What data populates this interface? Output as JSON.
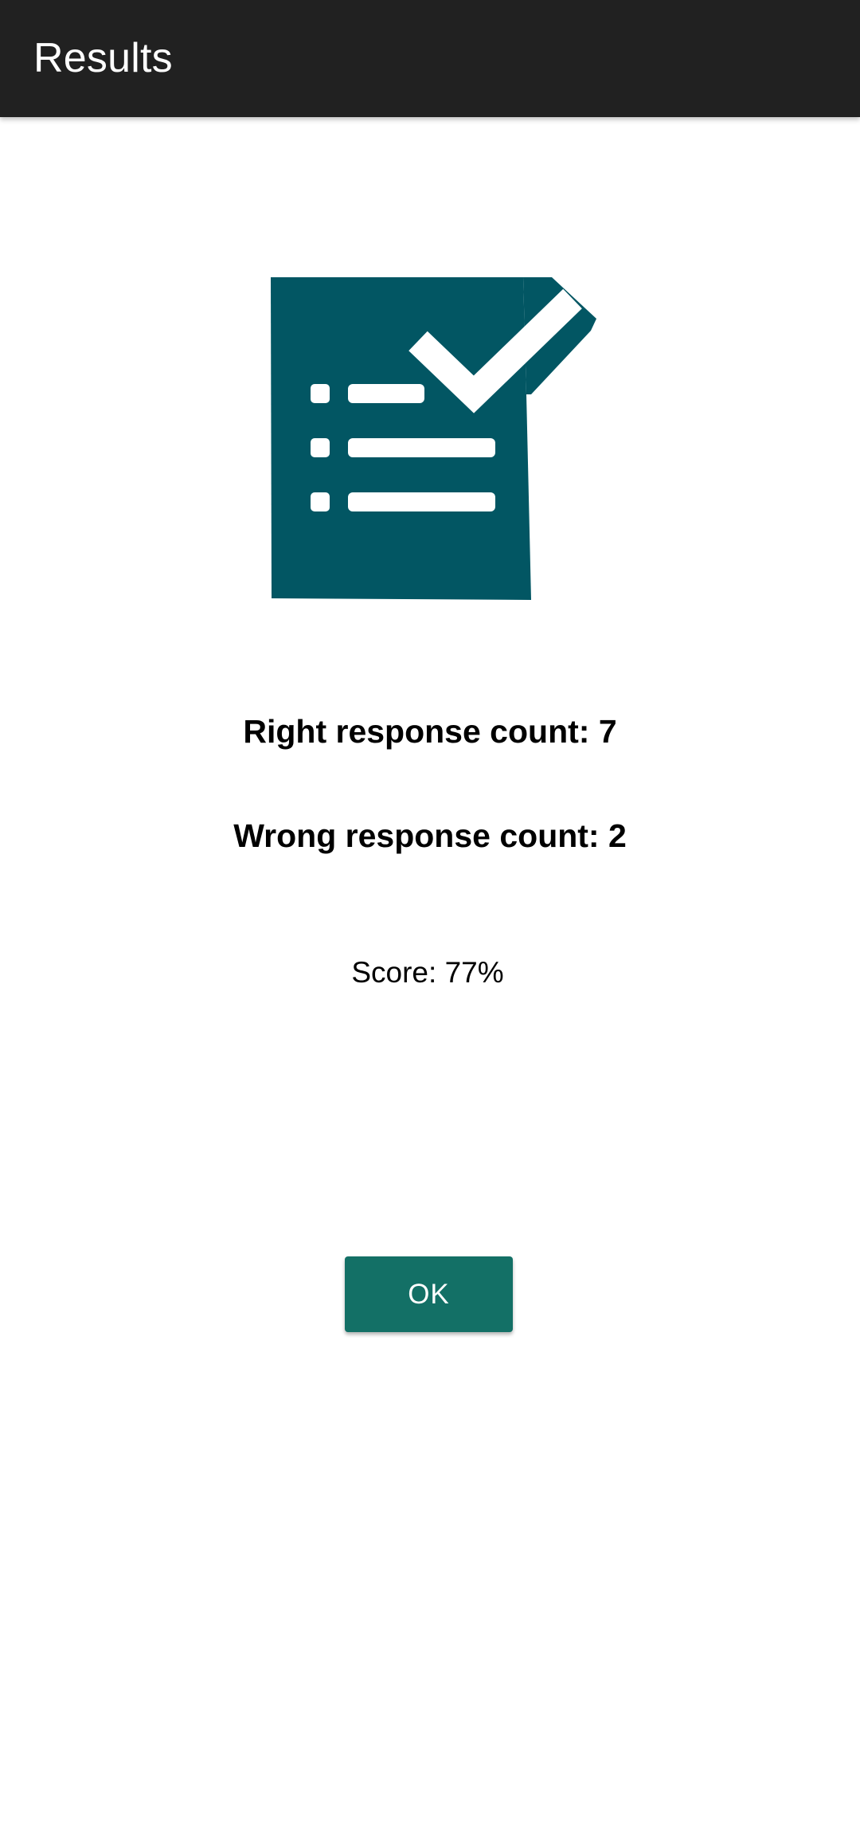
{
  "app_bar": {
    "title": "Results",
    "background_color": "#212121"
  },
  "illustration": {
    "icon": "checklist-document-icon",
    "color": "#025663"
  },
  "results": {
    "right_response_text": "Right response count: 7",
    "wrong_response_text": "Wrong response count: 2",
    "score_text": "Score: 77%"
  },
  "actions": {
    "ok_label": "OK",
    "ok_color": "#137066"
  }
}
